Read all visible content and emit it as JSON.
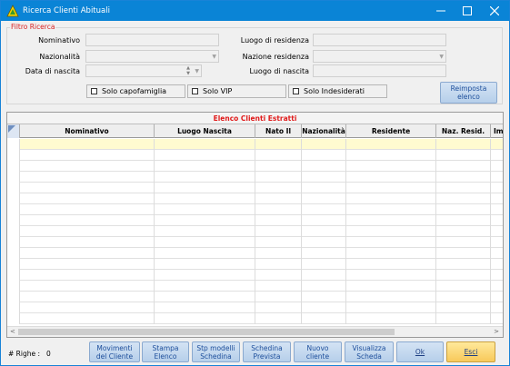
{
  "window": {
    "title": "Ricerca Clienti Abituali",
    "icon": "app-triangle-icon"
  },
  "filter": {
    "legend": "Filtro Ricerca",
    "nominativo_label": "Nominativo",
    "nominativo_value": "",
    "nazionalita_label": "Nazionalità",
    "nazionalita_value": "",
    "data_nascita_label": "Data di nascita",
    "data_nascita_value": "",
    "luogo_residenza_label": "Luogo di residenza",
    "luogo_residenza_value": "",
    "nazione_residenza_label": "Nazione residenza",
    "nazione_residenza_value": "",
    "luogo_nascita_label": "Luogo di nascita",
    "luogo_nascita_value": "",
    "solo_capofamiglia": "Solo capofamiglia",
    "solo_vip": "Solo VIP",
    "solo_indesiderati": "Solo Indesiderati",
    "reimposta_line1": "Reimposta",
    "reimposta_line2": "elenco"
  },
  "grid": {
    "caption": "Elenco Clienti Estratti",
    "columns": [
      "Nominativo",
      "Luogo Nascita",
      "Nato Il",
      "Nazionalità",
      "Residente",
      "Naz. Resid.",
      "Im"
    ],
    "rows": []
  },
  "footer": {
    "count_label": "# Righe :",
    "count_value": "0",
    "buttons": [
      {
        "line1": "Movimenti",
        "line2": "del Cliente"
      },
      {
        "line1": "Stampa",
        "line2": "Elenco"
      },
      {
        "line1": "Stp modelli",
        "line2": "Schedina"
      },
      {
        "line1": "Schedina",
        "line2": "Prevista"
      },
      {
        "line1": "Nuovo",
        "line2": "cliente"
      },
      {
        "line1": "Visualizza",
        "line2": "Scheda"
      },
      {
        "line1": "Ok",
        "line2": ""
      },
      {
        "line1": "Esci",
        "line2": ""
      }
    ]
  },
  "colors": {
    "titlebar": "#0a84d6",
    "legend": "#d81e1e",
    "grid_caption": "#e01b1b",
    "selected_row": "#fffbd0"
  }
}
